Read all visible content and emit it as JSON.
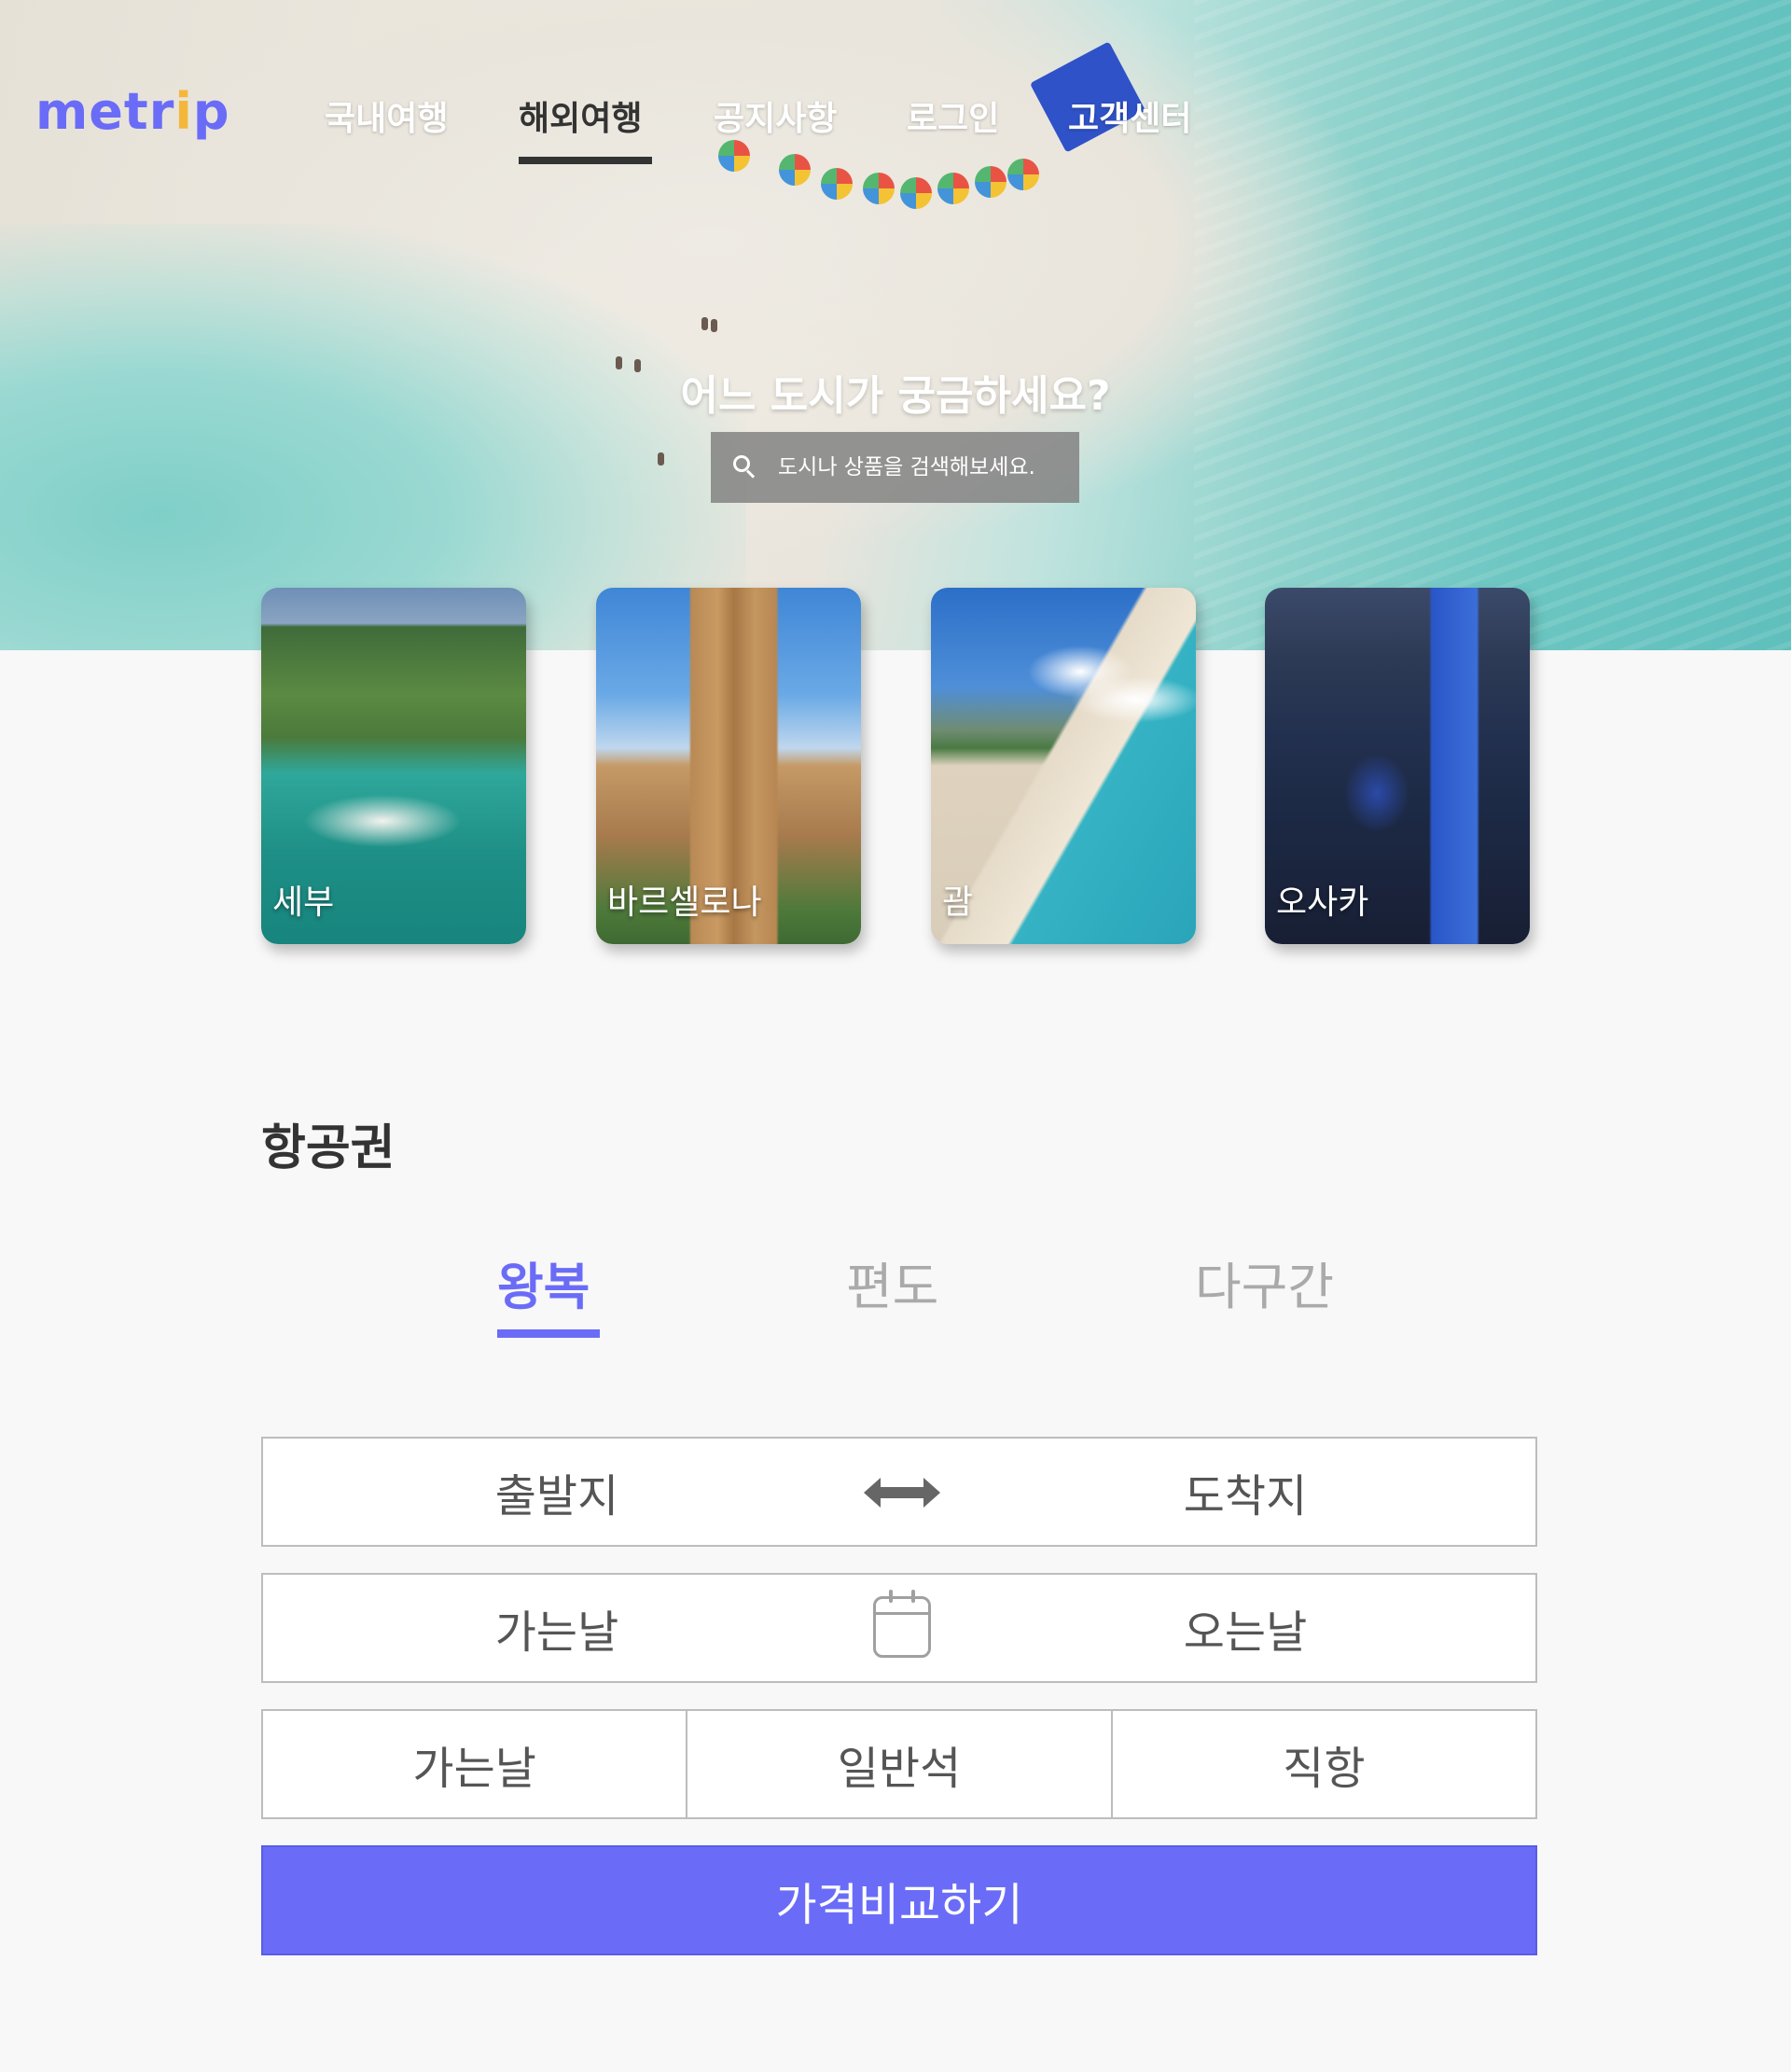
{
  "brand": {
    "logo_prefix": "metr",
    "logo_key": "i",
    "logo_suffix": "p",
    "accent": "#6a6cf7",
    "key_color": "#f4b73a"
  },
  "nav": {
    "items": [
      {
        "label": "국내여행",
        "active": false
      },
      {
        "label": "해외여행",
        "active": true
      },
      {
        "label": "공지사항",
        "active": false
      },
      {
        "label": "로그인",
        "active": false
      },
      {
        "label": "고객센터",
        "active": false
      }
    ]
  },
  "hero": {
    "question": "어느 도시가 궁금하세요?",
    "search_placeholder": "도시나 상품을 검색해보세요.",
    "search_icon": "search-icon"
  },
  "cities": [
    {
      "name": "세부"
    },
    {
      "name": "바르셀로나"
    },
    {
      "name": "괌"
    },
    {
      "name": "오사카"
    }
  ],
  "flight": {
    "title": "항공권",
    "tabs": [
      {
        "label": "왕복",
        "active": true
      },
      {
        "label": "편도",
        "active": false
      },
      {
        "label": "다구간",
        "active": false
      }
    ],
    "departure": "출발지",
    "arrival": "도착지",
    "swap_icon": "swap-arrows-icon",
    "go_date": "가는날",
    "return_date": "오는날",
    "calendar_icon": "calendar-icon",
    "options": [
      "가는날",
      "일반석",
      "직항"
    ],
    "compare_button": "가격비교하기"
  }
}
